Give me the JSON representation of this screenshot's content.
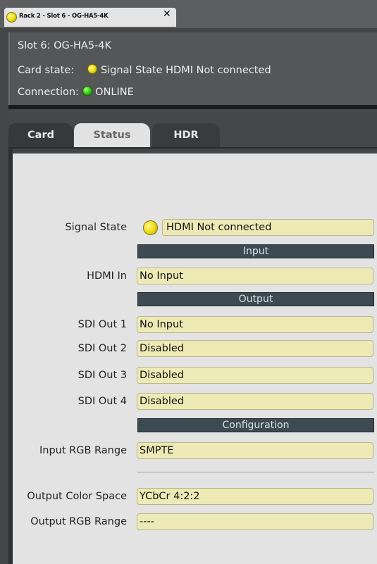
{
  "window": {
    "tab_title": "Rack 2 - Slot 6 - OG-HA5-4K",
    "close_glyph": "✕",
    "tab_led_color": "#f0e020"
  },
  "info": {
    "slot": "Slot 6: OG-HA5-4K",
    "card_state_label": "Card state:",
    "card_state_value": "Signal State HDMI Not connected",
    "card_state_led": "yellow",
    "connection_label": "Connection:",
    "connection_value": "ONLINE",
    "connection_led": "green"
  },
  "tabs": [
    {
      "label": "Card",
      "active": false
    },
    {
      "label": "Status",
      "active": true
    },
    {
      "label": "HDR",
      "active": false
    }
  ],
  "status": {
    "signal_state_label": "Signal State",
    "signal_state_value": "HDMI Not connected",
    "signal_led": "yellow",
    "input_header": "Input",
    "hdmi_in_label": "HDMI In",
    "hdmi_in_value": "No Input",
    "output_header": "Output",
    "sdi_out_1_label": "SDI Out 1",
    "sdi_out_1_value": "No Input",
    "sdi_out_2_label": "SDI Out 2",
    "sdi_out_2_value": "Disabled",
    "sdi_out_3_label": "SDI Out 3",
    "sdi_out_3_value": "Disabled",
    "sdi_out_4_label": "SDI Out 4",
    "sdi_out_4_value": "Disabled",
    "configuration_header": "Configuration",
    "input_rgb_range_label": "Input RGB Range",
    "input_rgb_range_value": "SMPTE",
    "output_color_space_label": "Output Color Space",
    "output_color_space_value": "YCbCr 4:2:2",
    "output_rgb_range_label": "Output RGB Range",
    "output_rgb_range_value": "----"
  },
  "colors": {
    "field_bg": "#eeeab6",
    "header_bg": "#3e4a51",
    "panel_bg": "#e3e3e3"
  }
}
